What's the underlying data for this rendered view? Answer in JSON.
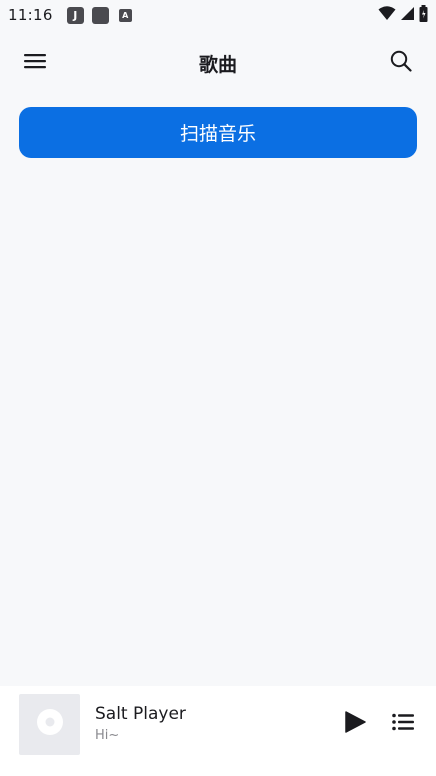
{
  "status_bar": {
    "time": "11:16",
    "notif_icons": [
      "J",
      "",
      "A"
    ]
  },
  "header": {
    "title": "歌曲",
    "menu_icon": "menu-icon",
    "search_icon": "search-icon"
  },
  "main": {
    "scan_button_label": "扫描音乐"
  },
  "mini_player": {
    "title": "Salt Player",
    "subtitle": "Hi~",
    "play_icon": "play-icon",
    "queue_icon": "queue-list-icon"
  },
  "colors": {
    "accent": "#0b6fe3",
    "background": "#f7f8fa"
  }
}
